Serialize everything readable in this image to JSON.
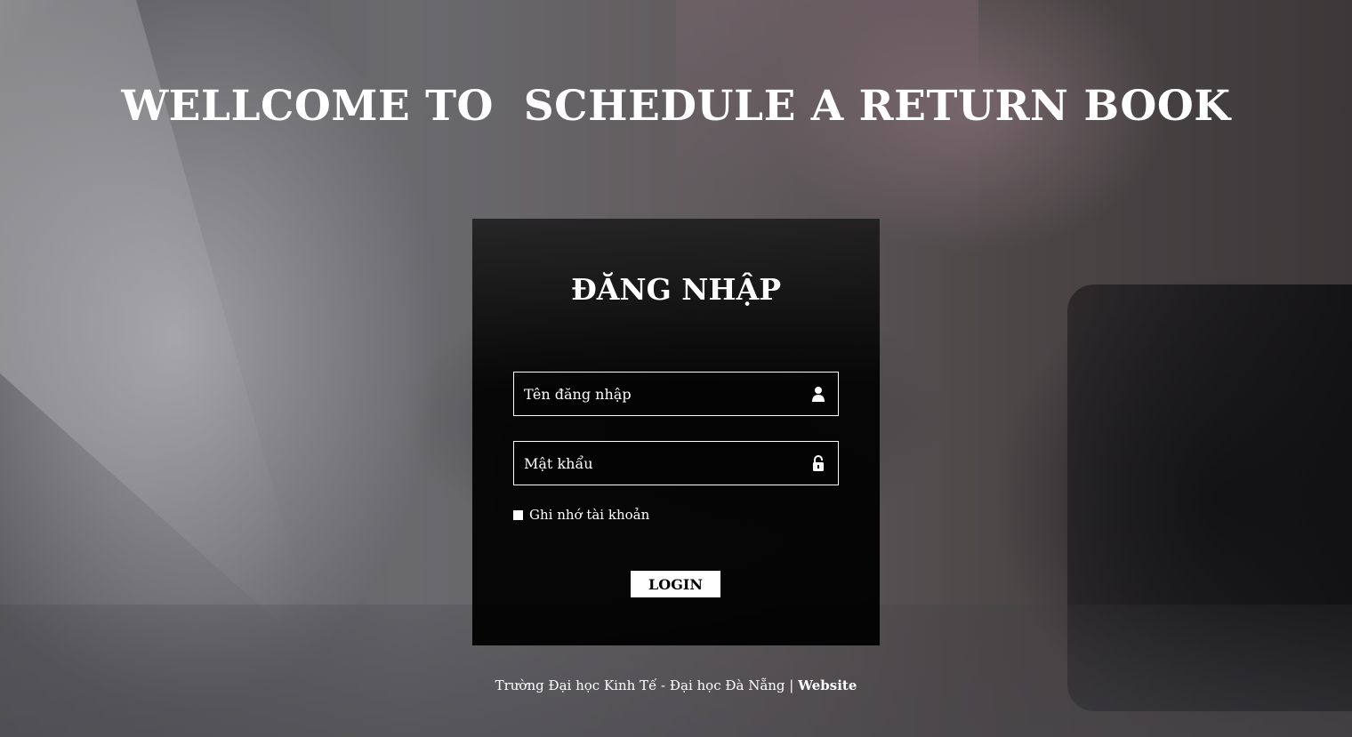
{
  "header": {
    "title": "WELLCOME TO  SCHEDULE A RETURN BOOK"
  },
  "login": {
    "title": "ĐĂNG NHẬP",
    "username": {
      "placeholder": "Tên đăng nhập",
      "value": "",
      "icon": "user-icon"
    },
    "password": {
      "placeholder": "Mật khẩu",
      "value": "",
      "icon": "lock-icon"
    },
    "remember_label": "Ghi nhớ tài khoản",
    "remember_checked": false,
    "submit_label": "LOGIN"
  },
  "footer": {
    "text": "Trường Đại học Kinh Tế - Đại học Đà Nẵng",
    "separator": " | ",
    "link_label": "Website"
  },
  "colors": {
    "text": "#ffffff",
    "panel": "#000000",
    "button_bg": "#ffffff",
    "button_text": "#000000"
  }
}
